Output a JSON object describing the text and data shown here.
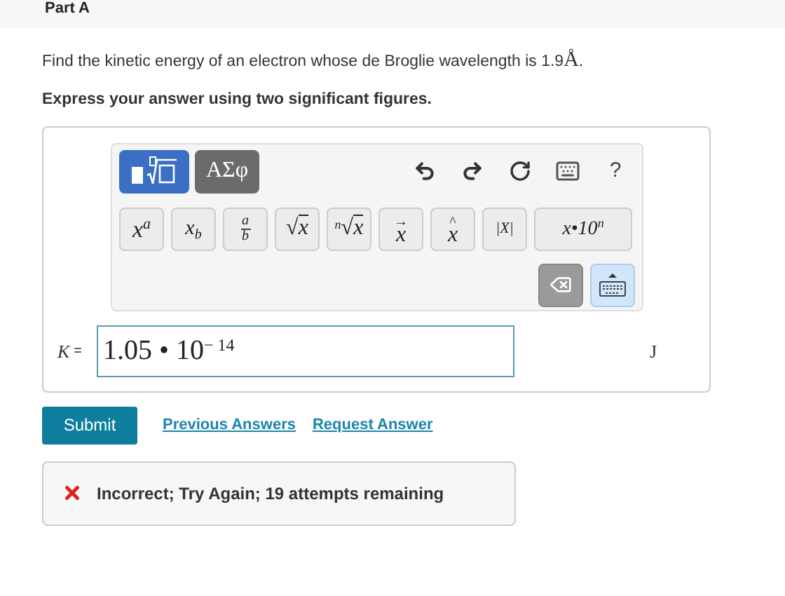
{
  "part_header": {
    "title": "Part A"
  },
  "question": {
    "text": "Find the kinetic energy of an electron whose de Broglie wavelength is 1.9 ",
    "unit_symbol": "Å",
    "end": ".",
    "instruction": "Express your answer using two significant figures."
  },
  "editor": {
    "template_tabs": [
      {
        "kind": "templates",
        "selected": true
      },
      {
        "kind": "greek",
        "label": "ΑΣφ",
        "selected": false
      }
    ],
    "tools": [
      {
        "kind": "undo"
      },
      {
        "kind": "redo"
      },
      {
        "kind": "reset"
      },
      {
        "kind": "keyboard"
      },
      {
        "kind": "help",
        "label": "?"
      }
    ],
    "symbols": [
      {
        "kind": "sup",
        "base": "x",
        "mark": "a"
      },
      {
        "kind": "sub",
        "base": "x",
        "mark": "b"
      },
      {
        "kind": "frac",
        "top": "a",
        "bottom": "b"
      },
      {
        "kind": "sqrt",
        "sign": "√",
        "base": "x"
      },
      {
        "kind": "nroot",
        "index": "n",
        "sign": "√",
        "base": "x"
      },
      {
        "kind": "vec",
        "accent": "→",
        "base": "x"
      },
      {
        "kind": "hat",
        "accent": "^",
        "base": "x"
      },
      {
        "kind": "abs",
        "label": "|X|"
      },
      {
        "kind": "sci",
        "label": "x•10",
        "mark": "n"
      }
    ],
    "actions": [
      {
        "kind": "backspace",
        "selected": false
      },
      {
        "kind": "keyboard_toggle",
        "selected": true
      }
    ]
  },
  "answer": {
    "variable": "K",
    "equals": "=",
    "value": "1.05 • 10$^{− 14}$",
    "unit": "J"
  },
  "buttons": {
    "submit": "Submit",
    "links": [
      "Previous Answers",
      "Request Answer"
    ]
  },
  "feedback": {
    "correct": false,
    "text": "Incorrect; Try Again; 19 attempts remaining"
  }
}
